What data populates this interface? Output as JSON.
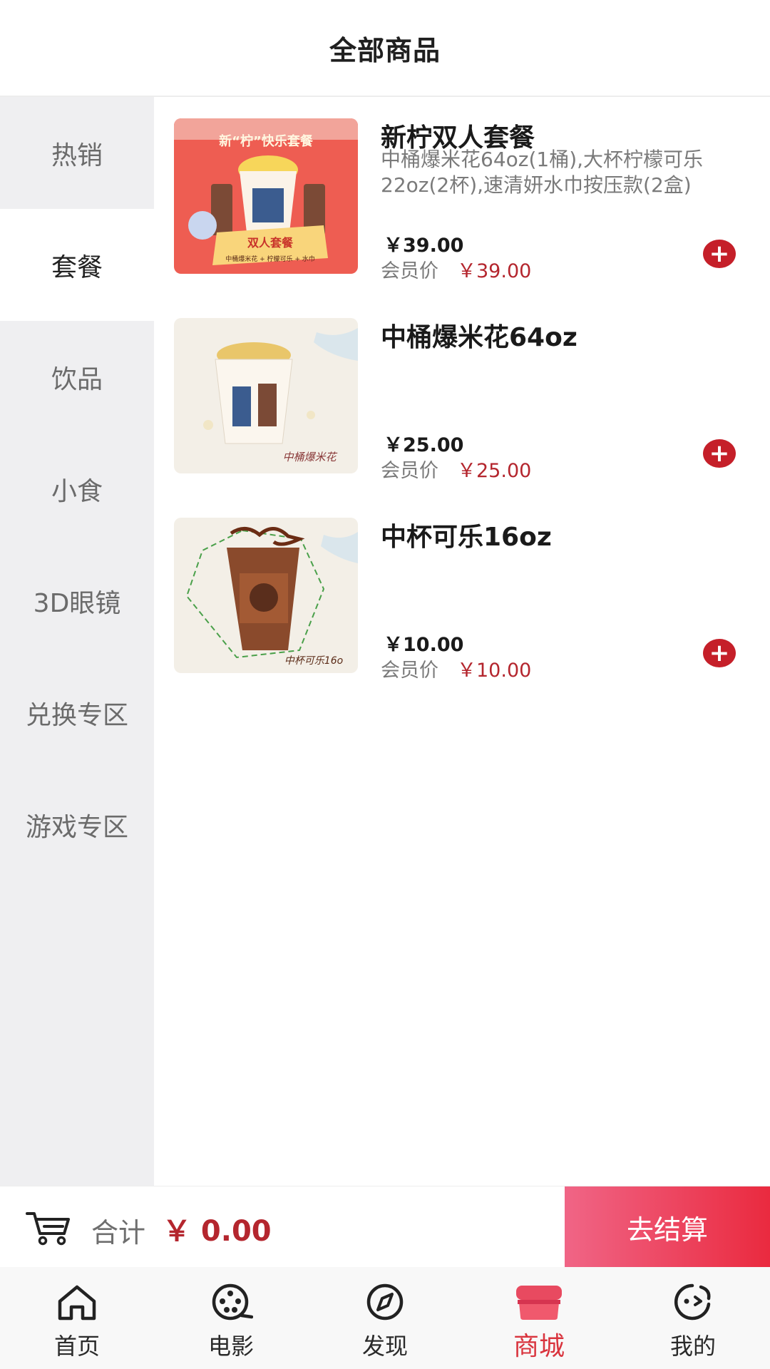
{
  "header": {
    "title": "全部商品"
  },
  "sidebar": {
    "categories": [
      "热销",
      "套餐",
      "饮品",
      "小食",
      "3D眼镜",
      "兑换专区",
      "游戏专区"
    ],
    "active": "套餐"
  },
  "products": [
    {
      "name": "新柠双人套餐",
      "desc": "中桶爆米花64oz(1桶),大杯柠檬可乐22oz(2杯),速清妍水巾按压款(2盒)",
      "price": "￥39.00",
      "member_label": "会员价",
      "member_price": "￥39.00",
      "image_text": {
        "top": "新“柠”快乐套餐",
        "banner": "双人套餐",
        "sub": "中桶爆米花 + 柠檬可乐 + 水巾"
      }
    },
    {
      "name": "中桶爆米花64oz",
      "desc": "",
      "price": "￥25.00",
      "member_label": "会员价",
      "member_price": "￥25.00",
      "image_text": {
        "caption": "中桶爆米花"
      }
    },
    {
      "name": "中杯可乐16oz",
      "desc": "",
      "price": "￥10.00",
      "member_label": "会员价",
      "member_price": "￥10.00",
      "image_text": {
        "caption": "中杯可乐16o"
      }
    }
  ],
  "cart": {
    "total_label": "合计",
    "total_value": "￥ 0.00",
    "checkout_label": "去结算"
  },
  "tabbar": {
    "tabs": [
      {
        "label": "首页",
        "icon": "home-icon"
      },
      {
        "label": "电影",
        "icon": "film-reel-icon"
      },
      {
        "label": "发现",
        "icon": "compass-icon"
      },
      {
        "label": "商城",
        "icon": "store-icon"
      },
      {
        "label": "我的",
        "icon": "profile-face-icon"
      }
    ],
    "active": "商城"
  },
  "colors": {
    "accent": "#c51f29",
    "price_red": "#b4262e",
    "checkout_start": "#f06586",
    "checkout_end": "#ea2a3f",
    "sidebar_bg": "#efeff1"
  }
}
